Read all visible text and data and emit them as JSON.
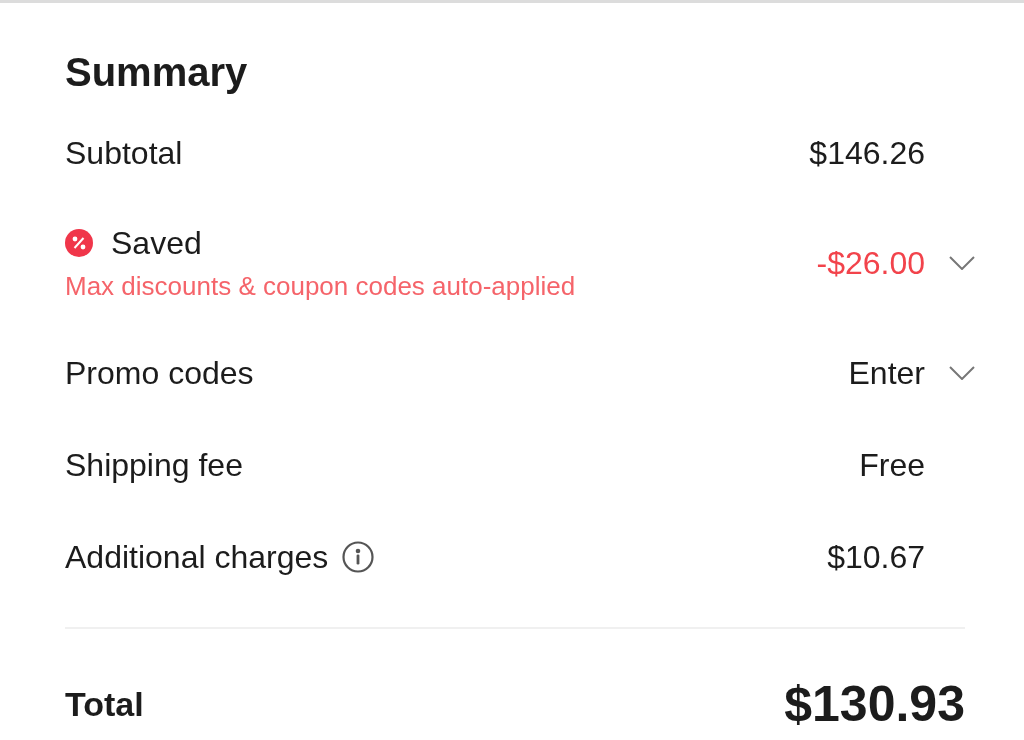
{
  "summary": {
    "title": "Summary",
    "rows": [
      {
        "kind": "plain",
        "label": "Subtotal",
        "value": "$146.26",
        "expandable": false,
        "info": false
      },
      {
        "kind": "savings",
        "label": "Saved",
        "note": "Max discounts & coupon codes auto-applied",
        "value": "-$26.00",
        "expandable": true,
        "info": false
      },
      {
        "kind": "plain",
        "label": "Promo codes",
        "value": "Enter",
        "expandable": true,
        "info": false
      },
      {
        "kind": "plain",
        "label": "Shipping fee",
        "value": "Free",
        "expandable": false,
        "info": false
      },
      {
        "kind": "plain",
        "label": "Additional charges",
        "value": "$10.67",
        "expandable": false,
        "info": true
      }
    ],
    "total": {
      "label": "Total",
      "value": "$130.93"
    }
  }
}
